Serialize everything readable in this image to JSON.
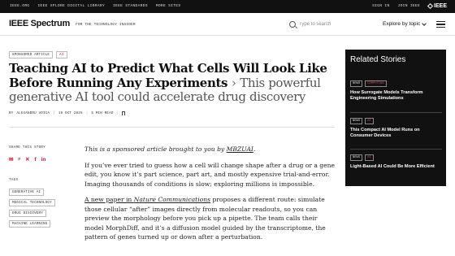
{
  "topbar": {
    "links": [
      "IEEE.ORG",
      "IEEE XPLORE DIGITAL LIBRARY",
      "IEEE STANDARDS",
      "MORE SITES"
    ],
    "sign_in": "SIGN IN",
    "join": "JOIN IEEE",
    "logo_text": "IEEE"
  },
  "header": {
    "brand": "IEEE Spectrum",
    "tagline": "FOR THE TECHNOLOGY INSIDER",
    "search_placeholder": "Type to search",
    "explore": "Explore by topic"
  },
  "article": {
    "badges": [
      "SPONSORED ARTICLE",
      "AI"
    ],
    "title": "Teaching AI to Predict What Cells Will Look Like Before Running Any Experiments",
    "separator": "›",
    "subtitle": "This powerful generative AI tool could accelerate drug discovery",
    "byline": {
      "by": "BY",
      "author": "ALEXANDRU VOICA",
      "date": "10 OCT 2025",
      "read_time": "5 MIN READ"
    },
    "share_label": "SHARE THIS STORY",
    "share_icons": [
      "✉",
      "ᵖ",
      "✕",
      "f",
      "in"
    ],
    "tags_label": "TAGS",
    "tags": [
      "GENERATIVE AI",
      "MEDICAL TECHNOLOGY",
      "DRUG DISCOVERY",
      "MACHINE LEARNING"
    ],
    "intro_prefix": "This is a sponsored article brought to you by ",
    "intro_link": "MBZUAI",
    "intro_suffix": ".",
    "p1": "If you’ve ever tried to guess how a cell will change shape after a drug or a gene edit, you know it’s part science, part art, and mostly expensive trial-and-error. Imaging thousands of conditions is slow; exploring millions is impossible.",
    "p2_link": "A new paper in ",
    "p2_journal": "Nature Communications",
    "p2_rest": " proposes a different route: simulate those cellular “after” images directly from molecular readouts, so you can preview the morphology before you pick up a pipette. The team calls their model MorphDiff, and it’s a diffusion model guided by the transcriptome, the pattern of genes turned up or down after a perturbation."
  },
  "related": {
    "heading": "Related Stories",
    "items": [
      {
        "tags": [
          "NEWS",
          "COMPUTING"
        ],
        "title": "How Surrogate Models Transform Engineering Simulations"
      },
      {
        "tags": [
          "NEWS",
          "AI"
        ],
        "title": "This Compact AI Model Runs on Consumer Devices"
      },
      {
        "tags": [
          "NEWS",
          "AI"
        ],
        "title": "Light-Based AI Could Be More Efficient"
      }
    ]
  },
  "colors": {
    "accent": "#c8102e",
    "dark": "#111111"
  }
}
